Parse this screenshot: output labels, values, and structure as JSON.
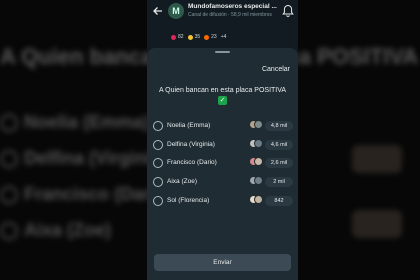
{
  "background": {
    "title": "A Quien bancan en esta placa POSITIVA",
    "rows": [
      "Noelia (Emma)",
      "Delfina (Virginia)",
      "Francisco (Dario)",
      "Aixa (Zoe)"
    ]
  },
  "header": {
    "back_icon": "arrow-left-icon",
    "channel_name": "Mundofamoseros especial ...",
    "channel_subtitle": "Canal de difusión · 58,9 mil miembros",
    "bell_icon": "bell-icon"
  },
  "reactions": [
    {
      "icon": "heart",
      "color": "#e0245e",
      "count": "82"
    },
    {
      "icon": "laugh",
      "color": "#f4c430",
      "count": "35"
    },
    {
      "icon": "fire",
      "color": "#ff6a00",
      "count": "23"
    },
    {
      "icon": "more",
      "color": "#8696a0",
      "count": "+4"
    }
  ],
  "poll": {
    "cancel_label": "Cancelar",
    "question": "A Quien bancan en esta placa POSITIVA",
    "question_emoji": "✓",
    "options": [
      {
        "label": "Noelia (Emma)",
        "votes": "4,8 mil",
        "voter_colors": [
          "#b9a28a",
          "#7f8c8d"
        ]
      },
      {
        "label": "Delfina (Virginia)",
        "votes": "4,6 mil",
        "voter_colors": [
          "#c0c0c0",
          "#6b7b85"
        ]
      },
      {
        "label": "Francisco (Dario)",
        "votes": "2,6 mil",
        "voter_colors": [
          "#d48a8a",
          "#c9b7a7"
        ]
      },
      {
        "label": "Aixa (Zoe)",
        "votes": "2 mil",
        "voter_colors": [
          "#9ea7ad",
          "#6f7e86"
        ]
      },
      {
        "label": "Sol (Florencia)",
        "votes": "842",
        "voter_colors": [
          "#e8dcc8",
          "#bfb3a1"
        ]
      }
    ],
    "send_label": "Enviar"
  }
}
